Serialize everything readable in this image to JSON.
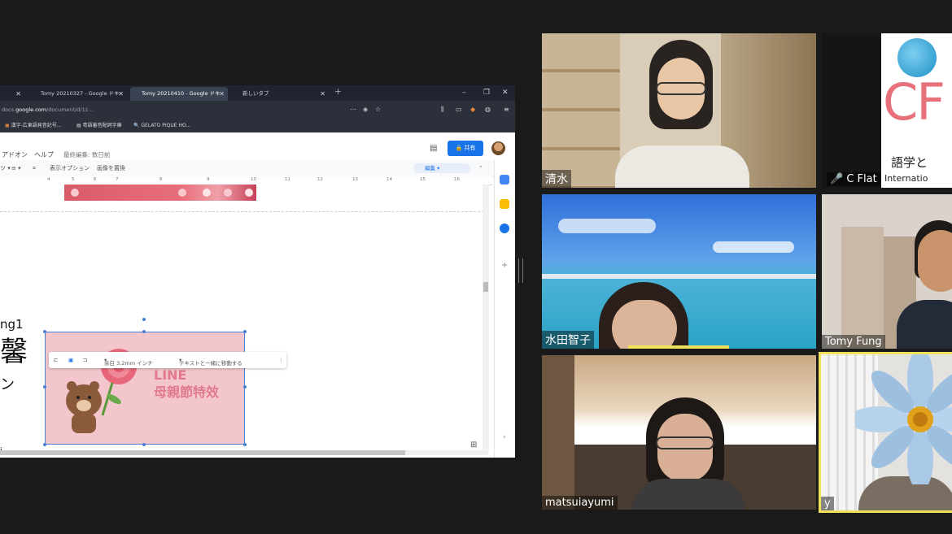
{
  "browser": {
    "tabs": [
      {
        "label": "Tomy 20210327 - Google ドキ"
      },
      {
        "label": "Tomy 20210410 - Google ドキ"
      },
      {
        "label": "新しいタブ"
      }
    ],
    "url_prefix": "docs.",
    "url_domain": "google.com",
    "url_rest": "/document/d/1z...",
    "bookmarks": [
      "漢字-広東語発音記号...",
      "粤語審音配詞字庫",
      "GELATO PIQUE HO..."
    ]
  },
  "doc": {
    "menu": [
      "アドオン",
      "ヘルプ",
      "最終編集: 数日前"
    ],
    "share_label": "共有",
    "toolbar": [
      "表示オプション",
      "画像を置換"
    ],
    "edit_mode": "編集",
    "ruler": [
      "4",
      "5",
      "6",
      "7",
      "8",
      "9",
      "10",
      "11",
      "12",
      "13",
      "14",
      "15",
      "16",
      "17"
    ],
    "left_fragments": [
      "ng1",
      "馨",
      "ン",
      "i"
    ],
    "image_text": {
      "line1": "LINE",
      "line2": "母親節特效"
    },
    "image_toolbar": [
      "余白 3.2mm インチ",
      "テキストと一緒に移動する"
    ]
  },
  "participants": [
    {
      "name": "清水"
    },
    {
      "name": "C Flat"
    },
    {
      "name": "水田智子"
    },
    {
      "name": "Tomy Fung"
    },
    {
      "name": "matsuiayumi"
    },
    {
      "name": "y"
    }
  ],
  "logo_text": {
    "cf": "CF",
    "sub": "語学と",
    "intl": "Internatio"
  }
}
